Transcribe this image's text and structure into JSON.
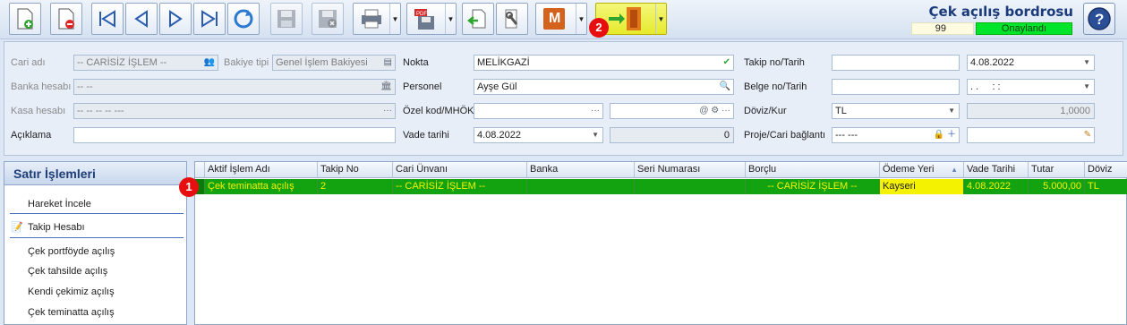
{
  "header": {
    "title": "Çek açılış bordrosu",
    "number": "99",
    "status": "Onaylandı"
  },
  "toolbar": {
    "icons": [
      "new-doc",
      "delete-doc",
      "first",
      "prev",
      "next",
      "last",
      "refresh",
      "save",
      "save-cancel",
      "print",
      "pdf-save",
      "import",
      "tools",
      "m-app",
      "exit"
    ],
    "m_label": "M",
    "accent_color": "#e6ea2c"
  },
  "form": {
    "cari_label": "Cari adı",
    "cari_value": "-- CARİSİZ İŞLEM --",
    "bakiye_label": "Bakiye tipi",
    "bakiye_value": "Genel İşlem Bakiyesi",
    "banka_label": "Banka hesabı",
    "banka_value": "-- --",
    "kasa_label": "Kasa hesabı",
    "kasa_value": "-- -- -- -- ---",
    "aciklama_label": "Açıklama",
    "aciklama_value": "",
    "nokta_label": "Nokta",
    "nokta_value": "MELİKGAZİ",
    "personel_label": "Personel",
    "personel_value": "Ayşe Gül",
    "ozel_label": "Özel kod/MHÖK",
    "ozel_value": "",
    "ozel_value2": "",
    "vade_label": "Vade tarihi",
    "vade_value": "4.08.2022",
    "vade_extra": "0",
    "takip_label": "Takip no/Tarih",
    "takip_value": "",
    "takip_date": "4.08.2022",
    "belge_label": "Belge no/Tarih",
    "belge_value": "",
    "belge_date": ". .     : :",
    "doviz_label": "Döviz/Kur",
    "doviz_value": "TL",
    "kur_value": "1,0000",
    "proje_label": "Proje/Cari bağlantı",
    "proje_value": "--- ---",
    "proje_extra": ""
  },
  "side": {
    "title": "Satır İşlemleri",
    "items": [
      "Hareket İncele",
      "Takip Hesabı",
      "Çek portföyde açılış",
      "Çek tahsilde açılış",
      "Kendi çekimiz açılış",
      "Çek teminatta açılış"
    ]
  },
  "grid": {
    "columns": [
      "Aktif İşlem Adı",
      "Takip No",
      "Cari Ünvanı",
      "Banka",
      "Seri Numarası",
      "Borçlu",
      "Ödeme Yeri",
      "Vade Tarihi",
      "Tutar",
      "Döviz"
    ],
    "rows": [
      {
        "islem": "Çek teminatta açılış",
        "takip": "2",
        "cari": "-- CARİSİZ İŞLEM --",
        "banka": "",
        "seri": "",
        "borclu": "-- CARİSİZ İŞLEM --",
        "odeme": "Kayseri",
        "vade": "4.08.2022",
        "tutar": "5.000,00",
        "doviz": "TL"
      }
    ]
  },
  "annotations": {
    "badge1": "1",
    "badge2": "2"
  }
}
